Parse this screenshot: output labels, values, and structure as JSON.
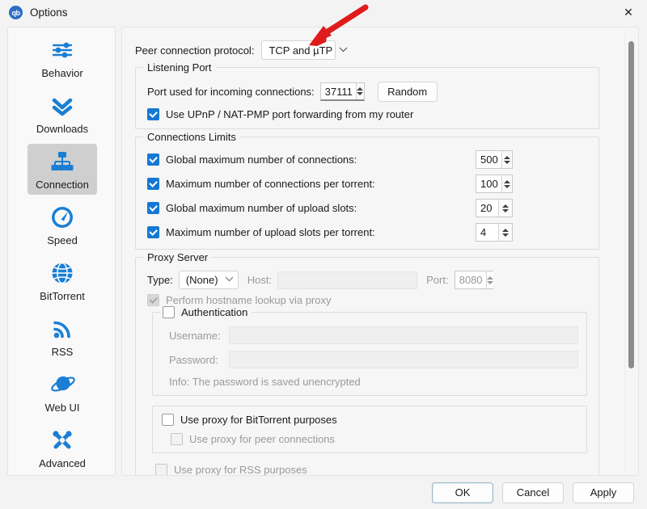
{
  "window": {
    "title": "Options",
    "app_icon": "qb",
    "close_icon": "close-icon"
  },
  "sidebar": {
    "items": [
      {
        "label": "Behavior",
        "icon": "sliders-icon",
        "selected": false
      },
      {
        "label": "Downloads",
        "icon": "double-chevron-down-icon",
        "selected": false
      },
      {
        "label": "Connection",
        "icon": "network-nodes-icon",
        "selected": true
      },
      {
        "label": "Speed",
        "icon": "speedometer-icon",
        "selected": false
      },
      {
        "label": "BitTorrent",
        "icon": "globe-icon",
        "selected": false
      },
      {
        "label": "RSS",
        "icon": "rss-icon",
        "selected": false
      },
      {
        "label": "Web UI",
        "icon": "planet-icon",
        "selected": false
      },
      {
        "label": "Advanced",
        "icon": "tools-icon",
        "selected": false
      }
    ]
  },
  "connection": {
    "peer_protocol": {
      "label": "Peer connection protocol:",
      "value": "TCP and µTP",
      "chevron": "⌄"
    },
    "listening_port": {
      "title": "Listening Port",
      "port_label": "Port used for incoming connections:",
      "port_value": "37111",
      "random_button": "Random",
      "upnp_label": "Use UPnP / NAT-PMP port forwarding from my router",
      "upnp_checked": true
    },
    "connections_limits": {
      "title": "Connections Limits",
      "rows": [
        {
          "label": "Global maximum number of connections:",
          "value": "500",
          "checked": true
        },
        {
          "label": "Maximum number of connections per torrent:",
          "value": "100",
          "checked": true
        },
        {
          "label": "Global maximum number of upload slots:",
          "value": "20",
          "checked": true
        },
        {
          "label": "Maximum number of upload slots per torrent:",
          "value": "4",
          "checked": true
        }
      ]
    },
    "proxy_server": {
      "title": "Proxy Server",
      "type_label": "Type:",
      "type_value": "(None)",
      "host_label": "Host:",
      "host_value": "",
      "port_label": "Port:",
      "port_value": "8080",
      "hostname_lookup_label": "Perform hostname lookup via proxy",
      "hostname_lookup_checked": true,
      "authentication": {
        "title": "Authentication",
        "checked": false,
        "username_label": "Username:",
        "username_value": "",
        "password_label": "Password:",
        "password_value": "",
        "info": "Info: The password is saved unencrypted"
      },
      "use_for_bittorrent_label": "Use proxy for BitTorrent purposes",
      "use_for_bittorrent_checked": false,
      "use_for_peer_label": "Use proxy for peer connections",
      "use_for_peer_checked": false,
      "use_for_rss_label": "Use proxy for RSS purposes",
      "use_for_rss_checked": false
    }
  },
  "buttons": {
    "ok": "OK",
    "cancel": "Cancel",
    "apply": "Apply"
  },
  "annotation": {
    "arrow_color": "#e01b1b"
  },
  "colors": {
    "accent_blue": "#1478d4",
    "icon_blue": "#1a7fd4",
    "selected_bg": "#cfcfcf",
    "arrow_red": "#e01b1b"
  }
}
